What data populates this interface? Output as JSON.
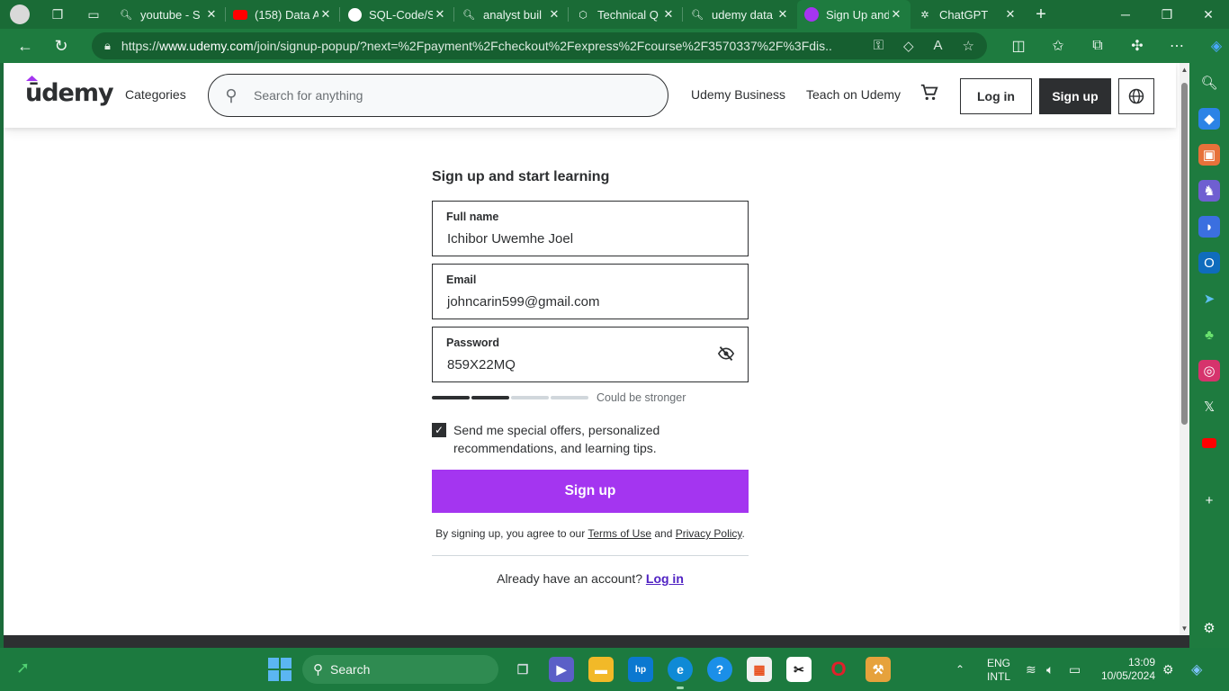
{
  "browser": {
    "tabs": [
      {
        "label": "youtube - S",
        "icon": "search-icon"
      },
      {
        "label": "(158) Data A",
        "icon": "youtube-icon"
      },
      {
        "label": "SQL-Code/S",
        "icon": "github-icon"
      },
      {
        "label": "analyst buil",
        "icon": "search-icon"
      },
      {
        "label": "Technical Q",
        "icon": "site-icon"
      },
      {
        "label": "udemy data",
        "icon": "search-icon"
      },
      {
        "label": "Sign Up and",
        "icon": "udemy-icon"
      },
      {
        "label": "ChatGPT",
        "icon": "chatgpt-icon"
      }
    ],
    "url_prefix": "https://",
    "url_host": "www.udemy.com",
    "url_path": "/join/signup-popup/?next=%2Fpayment%2Fcheckout%2Fexpress%2Fcourse%2F3570337%2F%3Fdis..."
  },
  "header": {
    "logo": "ūdemy",
    "categories": "Categories",
    "search_placeholder": "Search for anything",
    "business": "Udemy Business",
    "teach": "Teach on Udemy",
    "login": "Log in",
    "signup": "Sign up"
  },
  "form": {
    "heading": "Sign up and start learning",
    "fullname_label": "Full name",
    "fullname_value": "Ichibor Uwemhe Joel",
    "email_label": "Email",
    "email_value": "johncarin599@gmail.com",
    "password_label": "Password",
    "password_value": "859X22MQ",
    "strength_text": "Could be stronger",
    "strength_level": 0.5,
    "optin_text": "Send me special offers, personalized recommendations, and learning tips.",
    "optin_checked": true,
    "submit": "Sign up",
    "terms_prefix": "By signing up, you agree to our",
    "terms_link": "Terms of Use",
    "terms_and": "and",
    "privacy_link": "Privacy Policy",
    "terms_suffix": ".",
    "already_text": "Already have an account?",
    "already_link": "Log in"
  },
  "taskbar": {
    "search": "Search",
    "lang_line1": "ENG",
    "lang_line2": "INTL",
    "time": "13:09",
    "date": "10/05/2024"
  },
  "colors": {
    "accent": "#a435f0",
    "dark": "#2d2f31",
    "link": "#5022c3",
    "browser_green": "#1e7b3f"
  }
}
